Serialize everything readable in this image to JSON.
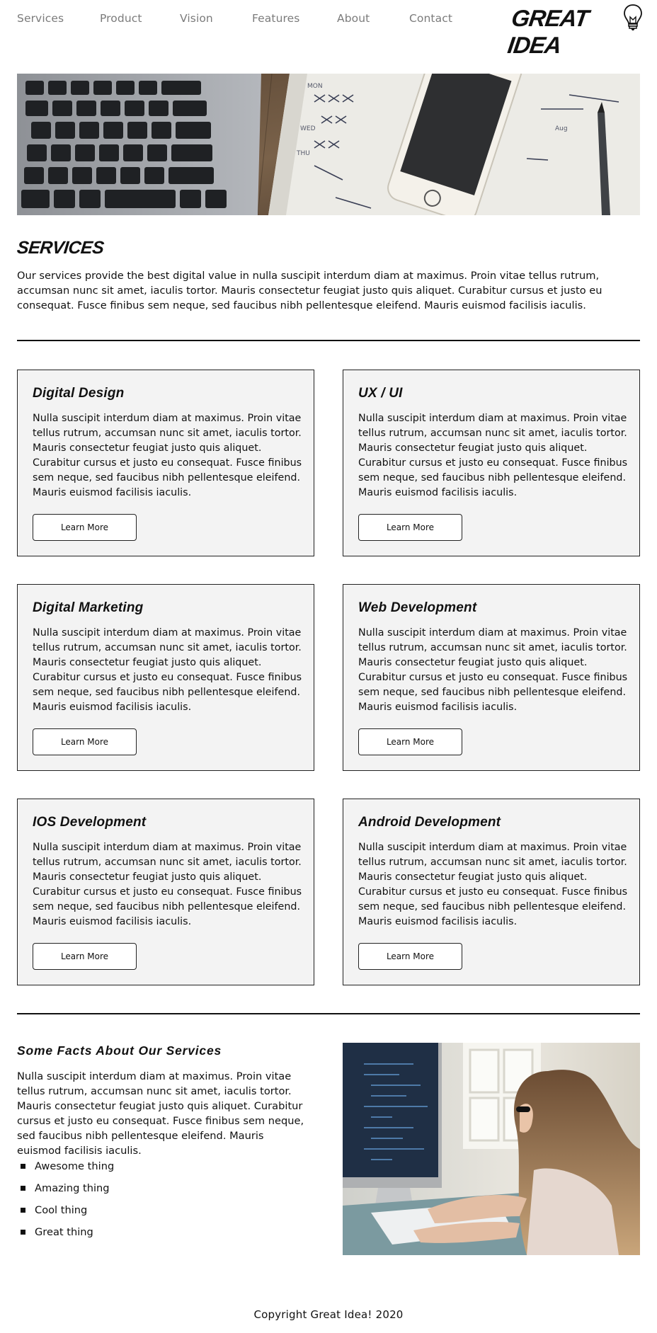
{
  "nav": {
    "items": [
      {
        "label": "Services"
      },
      {
        "label": "Product"
      },
      {
        "label": "Vision"
      },
      {
        "label": "Features"
      },
      {
        "label": "About"
      },
      {
        "label": "Contact"
      }
    ],
    "logo_text": "GREAT IDEA"
  },
  "services": {
    "title": "SERVICES",
    "intro": "Our services provide the best digital value in nulla suscipit interdum diam at maximus. Proin vitae tellus rutrum, accumsan nunc sit amet, iaculis tortor. Mauris consectetur feugiat justo quis aliquet. Curabitur cursus et justo eu consequat. Fusce finibus sem neque, sed faucibus nibh pellentesque eleifend. Mauris euismod facilisis iaculis."
  },
  "cards": [
    {
      "title": "Digital Design",
      "text": "Nulla suscipit interdum diam at maximus. Proin vitae tellus rutrum, accumsan nunc sit amet, iaculis tortor. Mauris consectetur feugiat justo quis aliquet. Curabitur cursus et justo eu consequat. Fusce finibus sem neque, sed faucibus nibh pellentesque eleifend. Mauris euismod facilisis iaculis.",
      "button": "Learn More"
    },
    {
      "title": "UX / UI",
      "text": "Nulla suscipit interdum diam at maximus. Proin vitae tellus rutrum, accumsan nunc sit amet, iaculis tortor. Mauris consectetur feugiat justo quis aliquet. Curabitur cursus et justo eu consequat. Fusce finibus sem neque, sed faucibus nibh pellentesque eleifend. Mauris euismod facilisis iaculis.",
      "button": "Learn More"
    },
    {
      "title": "Digital Marketing",
      "text": "Nulla suscipit interdum diam at maximus. Proin vitae tellus rutrum, accumsan nunc sit amet, iaculis tortor. Mauris consectetur feugiat justo quis aliquet. Curabitur cursus et justo eu consequat. Fusce finibus sem neque, sed faucibus nibh pellentesque eleifend. Mauris euismod facilisis iaculis.",
      "button": "Learn More"
    },
    {
      "title": "Web Development",
      "text": "Nulla suscipit interdum diam at maximus. Proin vitae tellus rutrum, accumsan nunc sit amet, iaculis tortor. Mauris consectetur feugiat justo quis aliquet. Curabitur cursus et justo eu consequat. Fusce finibus sem neque, sed faucibus nibh pellentesque eleifend. Mauris euismod facilisis iaculis.",
      "button": "Learn More"
    },
    {
      "title": "IOS Development",
      "text": "Nulla suscipit interdum diam at maximus. Proin vitae tellus rutrum, accumsan nunc sit amet, iaculis tortor. Mauris consectetur feugiat justo quis aliquet. Curabitur cursus et justo eu consequat. Fusce finibus sem neque, sed faucibus nibh pellentesque eleifend. Mauris euismod facilisis iaculis.",
      "button": "Learn More"
    },
    {
      "title": "Android Development",
      "text": "Nulla suscipit interdum diam at maximus. Proin vitae tellus rutrum, accumsan nunc sit amet, iaculis tortor. Mauris consectetur feugiat justo quis aliquet. Curabitur cursus et justo eu consequat. Fusce finibus sem neque, sed faucibus nibh pellentesque eleifend. Mauris euismod facilisis iaculis.",
      "button": "Learn More"
    }
  ],
  "facts": {
    "title": "Some Facts About Our Services",
    "text": "Nulla suscipit interdum diam at maximus. Proin vitae tellus rutrum, accumsan nunc sit amet, iaculis tortor. Mauris consectetur feugiat justo quis aliquet. Curabitur cursus et justo eu consequat. Fusce finibus sem neque, sed faucibus nibh pellentesque eleifend. Mauris euismod facilisis iaculis.",
    "items": [
      "Awesome thing",
      "Amazing thing",
      "Cool thing",
      "Great thing"
    ]
  },
  "footer": {
    "text": "Copyright Great Idea! 2020"
  },
  "colors": {
    "nav_text": "#7b7b7b",
    "card_bg": "#f3f3f3",
    "text": "#111111"
  },
  "icons": {
    "logo": "lightbulb-icon",
    "bullet": "square-bullet-icon"
  }
}
